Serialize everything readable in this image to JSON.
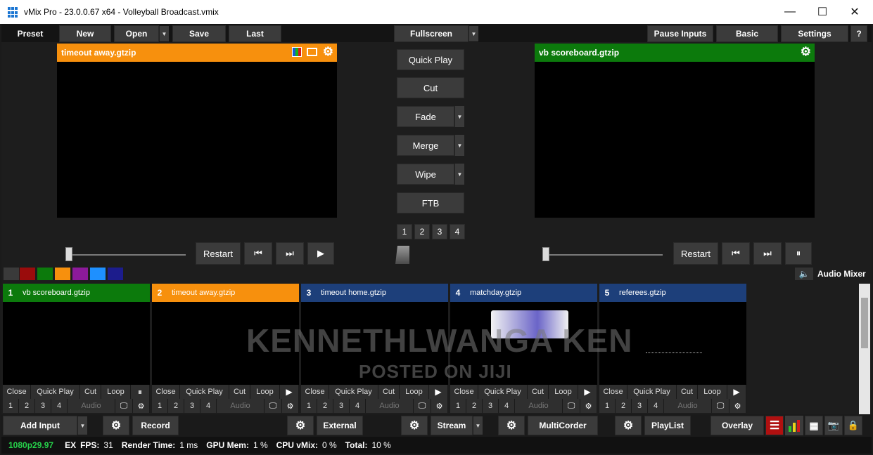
{
  "window": {
    "title": "vMix Pro - 23.0.0.67 x64 - Volleyball Broadcast.vmix",
    "minimize": "—",
    "maximize": "☐",
    "close": "✕"
  },
  "toolbar": {
    "preset": "Preset",
    "new": "New",
    "open": "Open",
    "save": "Save",
    "last": "Last",
    "fullscreen": "Fullscreen",
    "pause_inputs": "Pause Inputs",
    "basic": "Basic",
    "settings": "Settings",
    "help": "?"
  },
  "preview": {
    "title": "timeout away.gtzip",
    "color": "#f7900d",
    "restart": "Restart"
  },
  "output": {
    "title": "vb scoreboard.gtzip",
    "color": "#0c7a0c",
    "restart": "Restart"
  },
  "transitions": {
    "quick_play": "Quick Play",
    "cut": "Cut",
    "fade": "Fade",
    "merge": "Merge",
    "wipe": "Wipe",
    "ftb": "FTB",
    "numbers": [
      "1",
      "2",
      "3",
      "4"
    ]
  },
  "colors": [
    "#3a3a3a",
    "#9a0c0c",
    "#0c7a0c",
    "#f7900d",
    "#8c1a9a",
    "#1e90ff",
    "#1c1c8c"
  ],
  "audio_mixer": "Audio Mixer",
  "inputs": [
    {
      "num": "1",
      "name": "vb scoreboard.gtzip",
      "color": "#0c7a0c"
    },
    {
      "num": "2",
      "name": "timeout away.gtzip",
      "color": "#f7900d"
    },
    {
      "num": "3",
      "name": "timeout home.gtzip",
      "color": "#1d3f7a"
    },
    {
      "num": "4",
      "name": "matchday.gtzip",
      "color": "#1d3f7a"
    },
    {
      "num": "5",
      "name": "referees.gtzip",
      "color": "#1d3f7a"
    }
  ],
  "input_controls": {
    "close": "Close",
    "quick_play": "Quick Play",
    "cut": "Cut",
    "loop": "Loop",
    "audio": "Audio",
    "numbers": [
      "1",
      "2",
      "3",
      "4"
    ]
  },
  "bottom_bar": {
    "add_input": "Add Input",
    "record": "Record",
    "external": "External",
    "stream": "Stream",
    "multicorder": "MultiCorder",
    "playlist": "PlayList",
    "overlay": "Overlay"
  },
  "status": {
    "resolution": "1080p29.97",
    "ex": "EX",
    "fps_label": "FPS:",
    "fps": "31",
    "render_label": "Render Time:",
    "render": "1 ms",
    "gpu_label": "GPU Mem:",
    "gpu": "1 %",
    "cpu_label": "CPU vMix:",
    "cpu": "0 %",
    "total_label": "Total:",
    "total": "10 %"
  },
  "watermark": {
    "line1": "KENNETHLWANGA KEN",
    "line2": "POSTED ON JIJI"
  }
}
